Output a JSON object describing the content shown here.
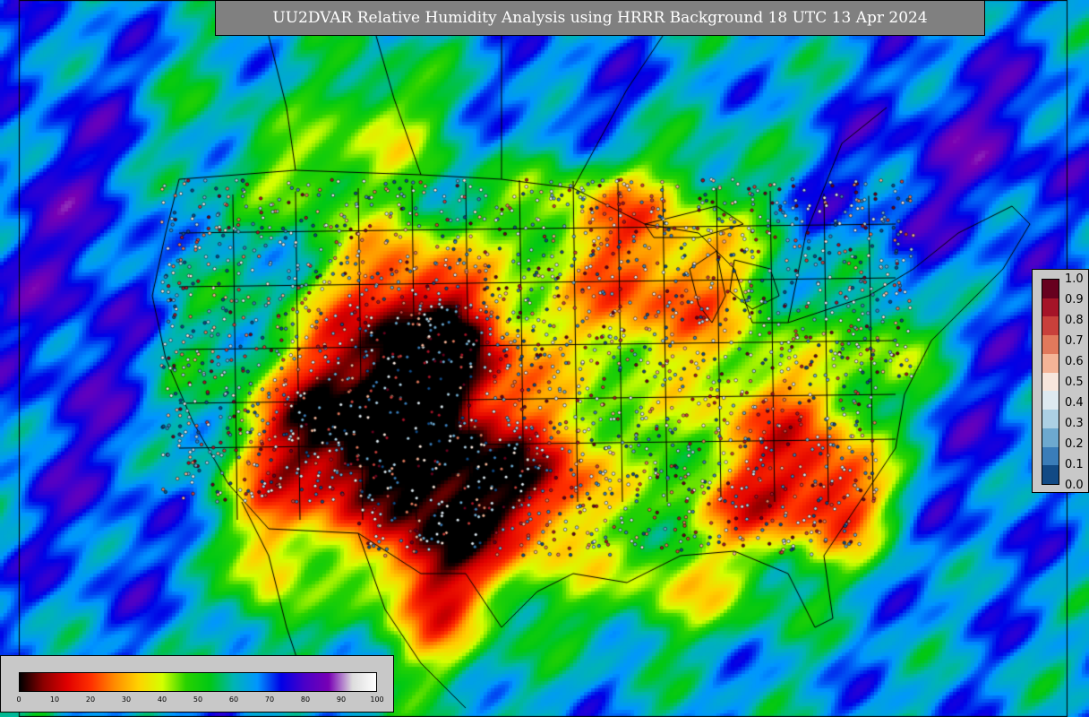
{
  "title": "UU2DVAR Relative Humidity Analysis using HRRR Background 18 UTC 13 Apr 2024",
  "dot_legend": {
    "labels": [
      "1.0",
      "0.9",
      "0.8",
      "0.7",
      "0.6",
      "0.5",
      "0.4",
      "0.3",
      "0.2",
      "0.1",
      "0.0"
    ],
    "colors": [
      "#67001f",
      "#a51428",
      "#c8403b",
      "#e1795c",
      "#f4b497",
      "#f7e6dc",
      "#dde9f0",
      "#acd0e4",
      "#6da9cf",
      "#3a7db9",
      "#114a85"
    ]
  },
  "rh_legend": {
    "labels": [
      "0",
      "10",
      "20",
      "30",
      "40",
      "50",
      "60",
      "70",
      "80",
      "90",
      "100"
    ],
    "gradient": [
      "#000000",
      "#8b0000",
      "#e00000",
      "#ff3000",
      "#ff8c00",
      "#ffd200",
      "#d4ff00",
      "#28d200",
      "#00c814",
      "#00b4b4",
      "#0096ff",
      "#0000e6",
      "#4b00c8",
      "#7800b4",
      "#dcdcdc",
      "#ffffff"
    ]
  }
}
